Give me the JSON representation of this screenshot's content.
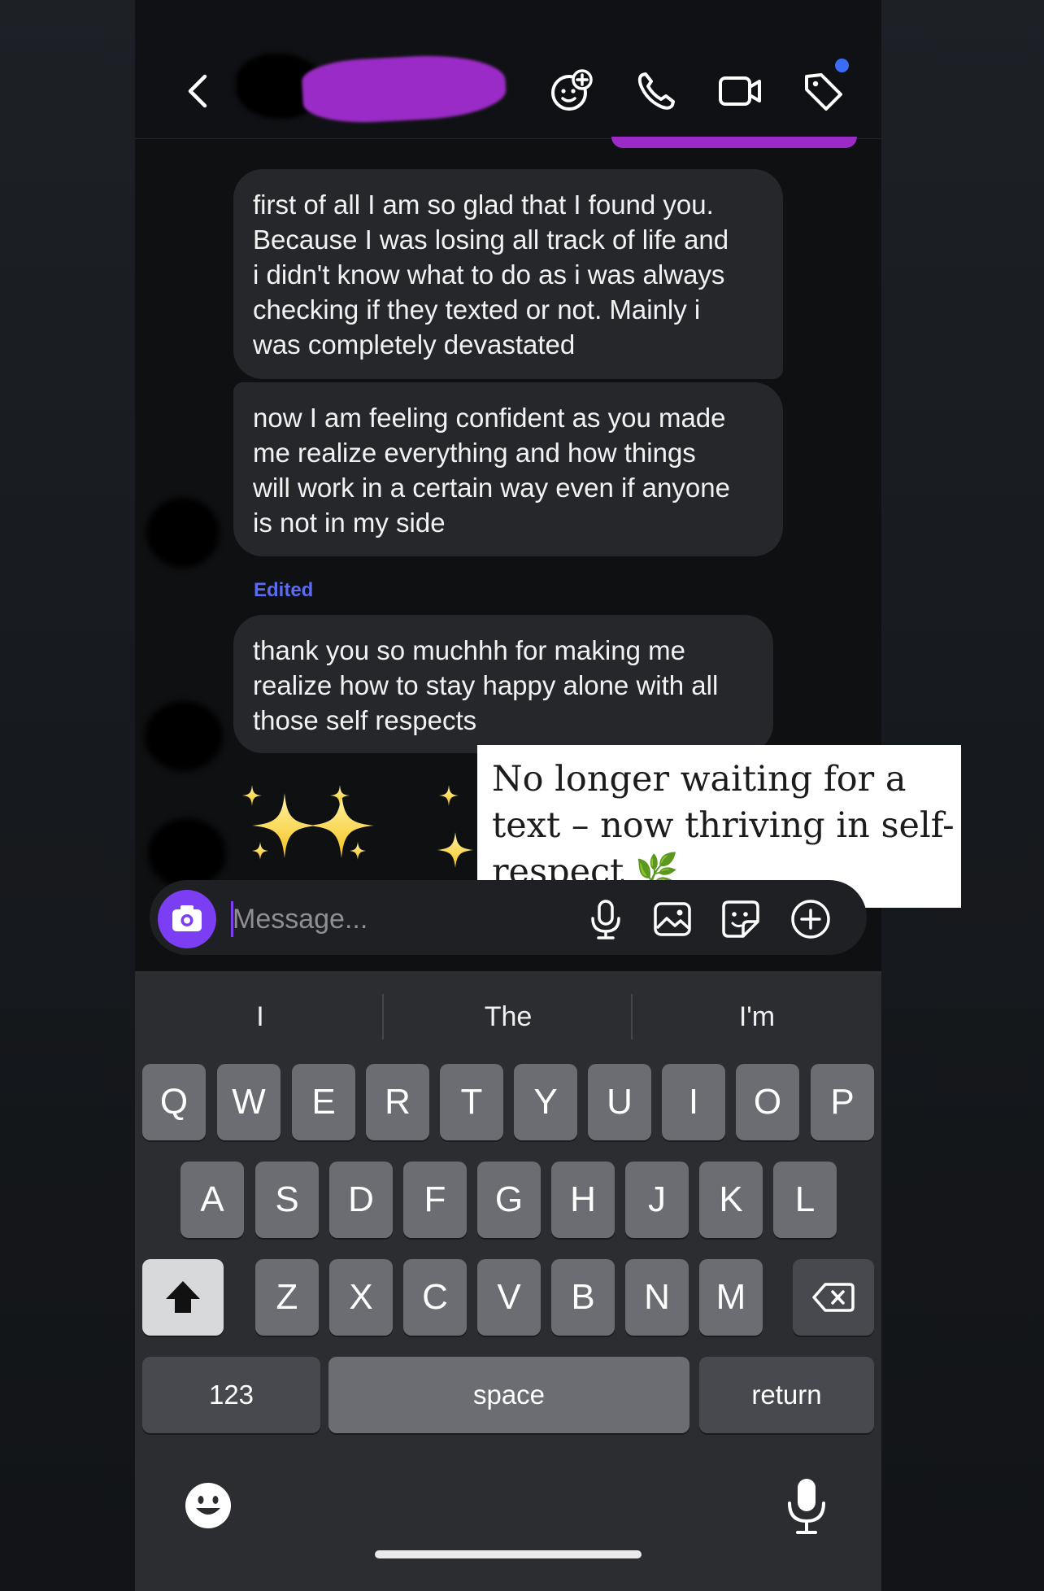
{
  "header": {
    "icons": [
      "back-arrow-icon",
      "add-effect-icon",
      "phone-icon",
      "video-icon",
      "tag-icon"
    ]
  },
  "messages": [
    {
      "text": "first of all I am so glad that I found you.\nBecause I was losing all track of life and\ni didn't know what to do as i was always\nchecking if they texted or not. Mainly i\nwas completely devastated"
    },
    {
      "text": "now I am feeling confident as you made\nme realize everything and how things\nwill work in a certain way even if anyone\nis not in my side"
    },
    {
      "text": "thank you so muchhh for making me\nrealize how to stay happy alone with all\nthose self respects"
    }
  ],
  "edited_label": "Edited",
  "sparkles_emoji": "✨✨✨",
  "caption": {
    "text": "No longer waiting for a\ntext – now thriving in self-\nrespect 🌿"
  },
  "composer": {
    "placeholder": "Message...",
    "value": ""
  },
  "keyboard": {
    "suggestions": [
      "I",
      "The",
      "I'm"
    ],
    "row1": [
      "Q",
      "W",
      "E",
      "R",
      "T",
      "Y",
      "U",
      "I",
      "O",
      "P"
    ],
    "row2": [
      "A",
      "S",
      "D",
      "F",
      "G",
      "H",
      "J",
      "K",
      "L"
    ],
    "row3": [
      "Z",
      "X",
      "C",
      "V",
      "B",
      "N",
      "M"
    ],
    "numbers_label": "123",
    "space_label": "space",
    "return_label": "return"
  },
  "colors": {
    "accent_purple": "#7b3ef2",
    "edited_blue": "#5b6cf0",
    "notification_dot": "#3b6cf5",
    "bubble_bg": "#26272b"
  }
}
